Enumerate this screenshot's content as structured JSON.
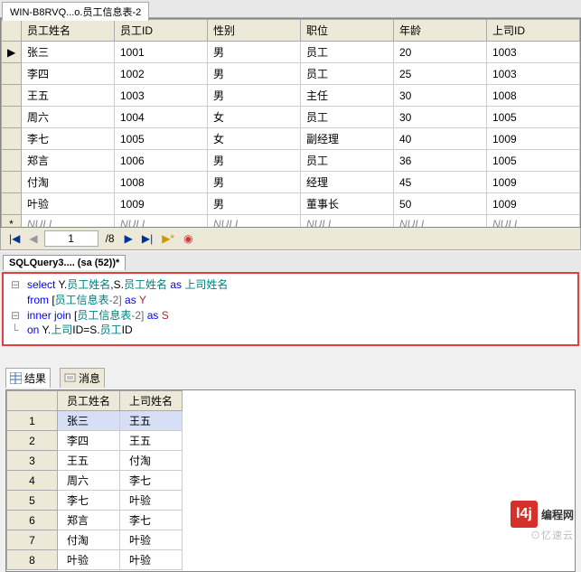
{
  "window_tab": "WIN-B8RVQ...o.员工信息表-2",
  "top_table": {
    "columns": [
      "员工姓名",
      "员工ID",
      "性别",
      "职位",
      "年龄",
      "上司ID"
    ],
    "rows": [
      {
        "name": "张三",
        "id": "1001",
        "sex": "男",
        "pos": "员工",
        "age": "20",
        "boss": "1003",
        "selector": "▶"
      },
      {
        "name": "李四",
        "id": "1002",
        "sex": "男",
        "pos": "员工",
        "age": "25",
        "boss": "1003",
        "selector": ""
      },
      {
        "name": "王五",
        "id": "1003",
        "sex": "男",
        "pos": "主任",
        "age": "30",
        "boss": "1008",
        "selector": ""
      },
      {
        "name": "周六",
        "id": "1004",
        "sex": "女",
        "pos": "员工",
        "age": "30",
        "boss": "1005",
        "selector": ""
      },
      {
        "name": "李七",
        "id": "1005",
        "sex": "女",
        "pos": "副经理",
        "age": "40",
        "boss": "1009",
        "selector": ""
      },
      {
        "name": "郑言",
        "id": "1006",
        "sex": "男",
        "pos": "员工",
        "age": "36",
        "boss": "1005",
        "selector": ""
      },
      {
        "name": "付淘",
        "id": "1008",
        "sex": "男",
        "pos": "经理",
        "age": "45",
        "boss": "1009",
        "selector": ""
      },
      {
        "name": "叶验",
        "id": "1009",
        "sex": "男",
        "pos": "董事长",
        "age": "50",
        "boss": "1009",
        "selector": ""
      },
      {
        "name": "NULL",
        "id": "NULL",
        "sex": "NULL",
        "pos": "NULL",
        "age": "NULL",
        "boss": "NULL",
        "selector": "*"
      }
    ]
  },
  "nav": {
    "first": "|◀",
    "prev": "◀",
    "current": "1",
    "total": "/8",
    "next": "▶",
    "last": "▶|",
    "play": "▶*",
    "stop": "◉"
  },
  "query_tab": "SQLQuery3.... (sa (52))*",
  "sql": {
    "l1a": "select",
    "l1b": " Y.",
    "l1c": "员工姓名",
    "l1d": ",S.",
    "l1e": "员工姓名",
    "l1f": " as ",
    "l1g": "上司姓名",
    "l2a": "from",
    "l2b": " [",
    "l2c": "员工信息表",
    "l2d": "-2] ",
    "l2e": "as",
    "l2f": " Y",
    "l3a": "inner join",
    "l3b": " [",
    "l3c": "员工信息表",
    "l3d": "-2] ",
    "l3e": "as",
    "l3f": " S",
    "l4a": "on",
    "l4b": " Y.",
    "l4c": "上司",
    "l4d": "ID=S.",
    "l4e": "员工",
    "l4f": "ID"
  },
  "results_tabs": {
    "results": "结果",
    "messages": "消息"
  },
  "result_table": {
    "columns": [
      "员工姓名",
      "上司姓名"
    ],
    "rows": [
      {
        "n": "1",
        "a": "张三",
        "b": "王五",
        "sel": true
      },
      {
        "n": "2",
        "a": "李四",
        "b": "王五"
      },
      {
        "n": "3",
        "a": "王五",
        "b": "付淘"
      },
      {
        "n": "4",
        "a": "周六",
        "b": "李七"
      },
      {
        "n": "5",
        "a": "李七",
        "b": "叶验"
      },
      {
        "n": "6",
        "a": "郑言",
        "b": "李七"
      },
      {
        "n": "7",
        "a": "付淘",
        "b": "叶验"
      },
      {
        "n": "8",
        "a": "叶验",
        "b": "叶验"
      }
    ]
  },
  "watermark": {
    "icon": "l4j",
    "text": "编程网",
    "sub": "⊙忆速云"
  }
}
